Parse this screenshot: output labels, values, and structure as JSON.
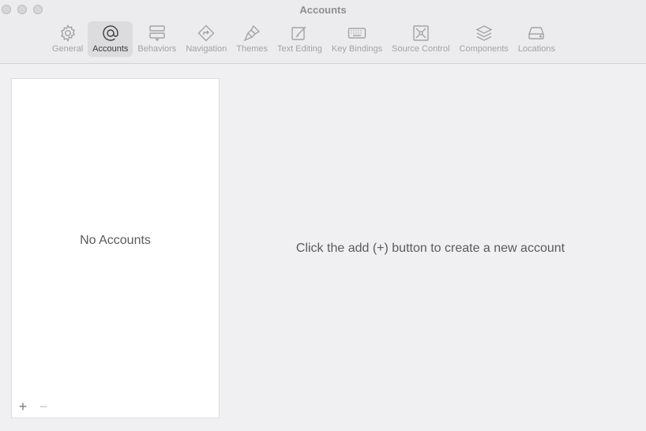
{
  "window": {
    "title": "Accounts"
  },
  "toolbar": {
    "tabs": [
      {
        "label": "General",
        "icon": "gear-icon",
        "active": false
      },
      {
        "label": "Accounts",
        "icon": "at-sign-icon",
        "active": true
      },
      {
        "label": "Behaviors",
        "icon": "behaviors-icon",
        "active": false
      },
      {
        "label": "Navigation",
        "icon": "navigation-icon",
        "active": false
      },
      {
        "label": "Themes",
        "icon": "paintbrush-icon",
        "active": false
      },
      {
        "label": "Text Editing",
        "icon": "edit-icon",
        "active": false
      },
      {
        "label": "Key Bindings",
        "icon": "keyboard-icon",
        "active": false
      },
      {
        "label": "Source Control",
        "icon": "source-control-icon",
        "active": false
      },
      {
        "label": "Components",
        "icon": "layers-icon",
        "active": false
      },
      {
        "label": "Locations",
        "icon": "drive-icon",
        "active": false
      }
    ]
  },
  "sidebar": {
    "empty_text": "No Accounts",
    "add_label": "+",
    "remove_label": "−"
  },
  "main": {
    "hint": "Click the add (+) button to create a new account"
  }
}
